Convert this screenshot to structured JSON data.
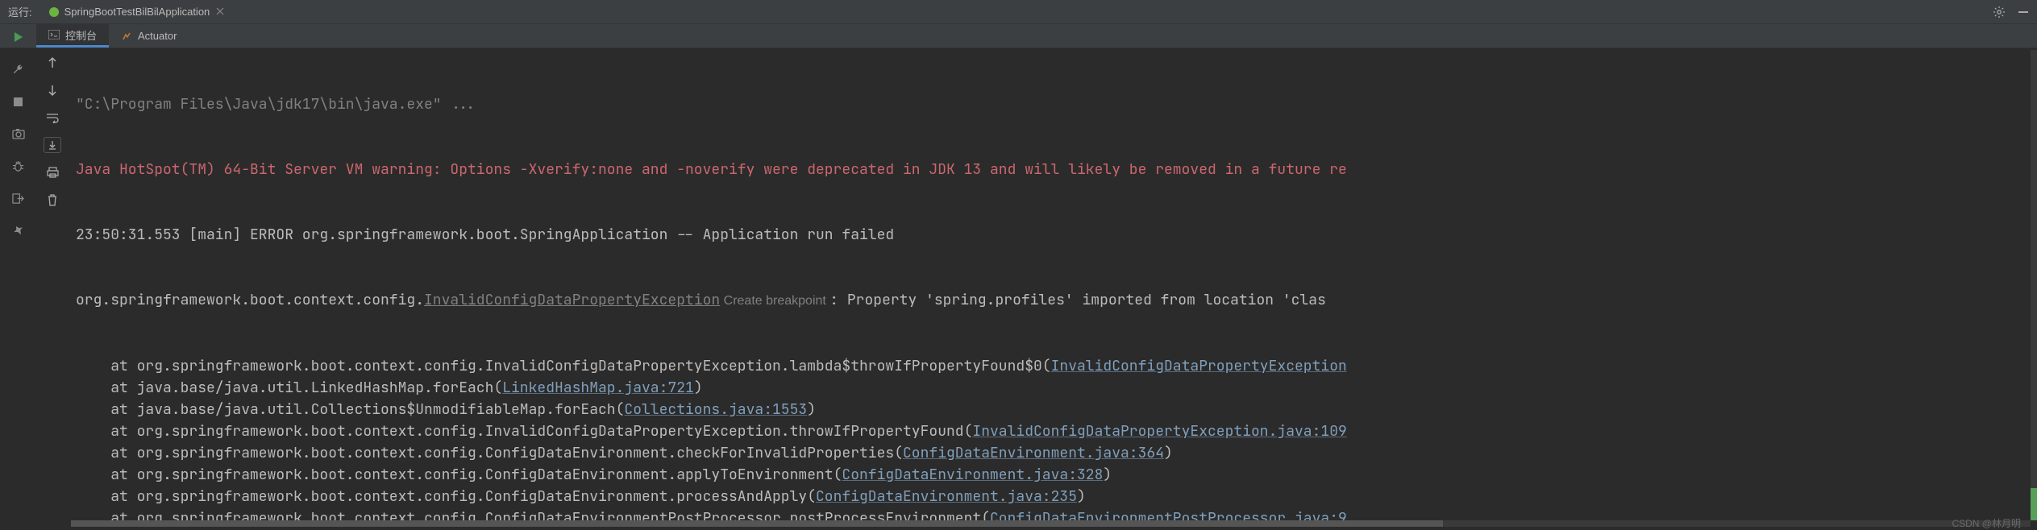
{
  "header": {
    "run_label": "运行:",
    "app_name": "SpringBootTestBilBilApplication"
  },
  "tabs": {
    "console": "控制台",
    "actuator": "Actuator"
  },
  "watermark": "CSDN @林月明",
  "console": {
    "cmd": "\"C:\\Program Files\\Java\\jdk17\\bin\\java.exe\" ...",
    "warn": "Java HotSpot(TM) 64-Bit Server VM warning: Options -Xverify:none and -noverify were deprecated in JDK 13 and will likely be removed in a future re",
    "err1": "23:50:31.553 [main] ERROR org.springframework.boot.SpringApplication -- Application run failed",
    "err2_pre": "org.springframework.boot.context.config.",
    "err2_ex": "InvalidConfigDataPropertyException",
    "err2_chip": " Create breakpoint ",
    "err2_post": ": Property 'spring.profiles' imported from location 'clas",
    "st": [
      {
        "pre": "    at org.springframework.boot.context.config.InvalidConfigDataPropertyException.lambda$throwIfPropertyFound$0(",
        "link": "InvalidConfigDataPropertyException",
        "post": ""
      },
      {
        "pre": "    at java.base/java.util.LinkedHashMap.forEach(",
        "link": "LinkedHashMap.java:721",
        "post": ")"
      },
      {
        "pre": "    at java.base/java.util.Collections$UnmodifiableMap.forEach(",
        "link": "Collections.java:1553",
        "post": ")"
      },
      {
        "pre": "    at org.springframework.boot.context.config.InvalidConfigDataPropertyException.throwIfPropertyFound(",
        "link": "InvalidConfigDataPropertyException.java:109",
        "post": ""
      },
      {
        "pre": "    at org.springframework.boot.context.config.ConfigDataEnvironment.checkForInvalidProperties(",
        "link": "ConfigDataEnvironment.java:364",
        "post": ")"
      },
      {
        "pre": "    at org.springframework.boot.context.config.ConfigDataEnvironment.applyToEnvironment(",
        "link": "ConfigDataEnvironment.java:328",
        "post": ")"
      },
      {
        "pre": "    at org.springframework.boot.context.config.ConfigDataEnvironment.processAndApply(",
        "link": "ConfigDataEnvironment.java:235",
        "post": ")"
      },
      {
        "pre": "    at org.springframework.boot.context.config.ConfigDataEnvironmentPostProcessor.postProcessEnvironment(",
        "link": "ConfigDataEnvironmentPostProcessor.java:9",
        "post": ""
      }
    ]
  }
}
